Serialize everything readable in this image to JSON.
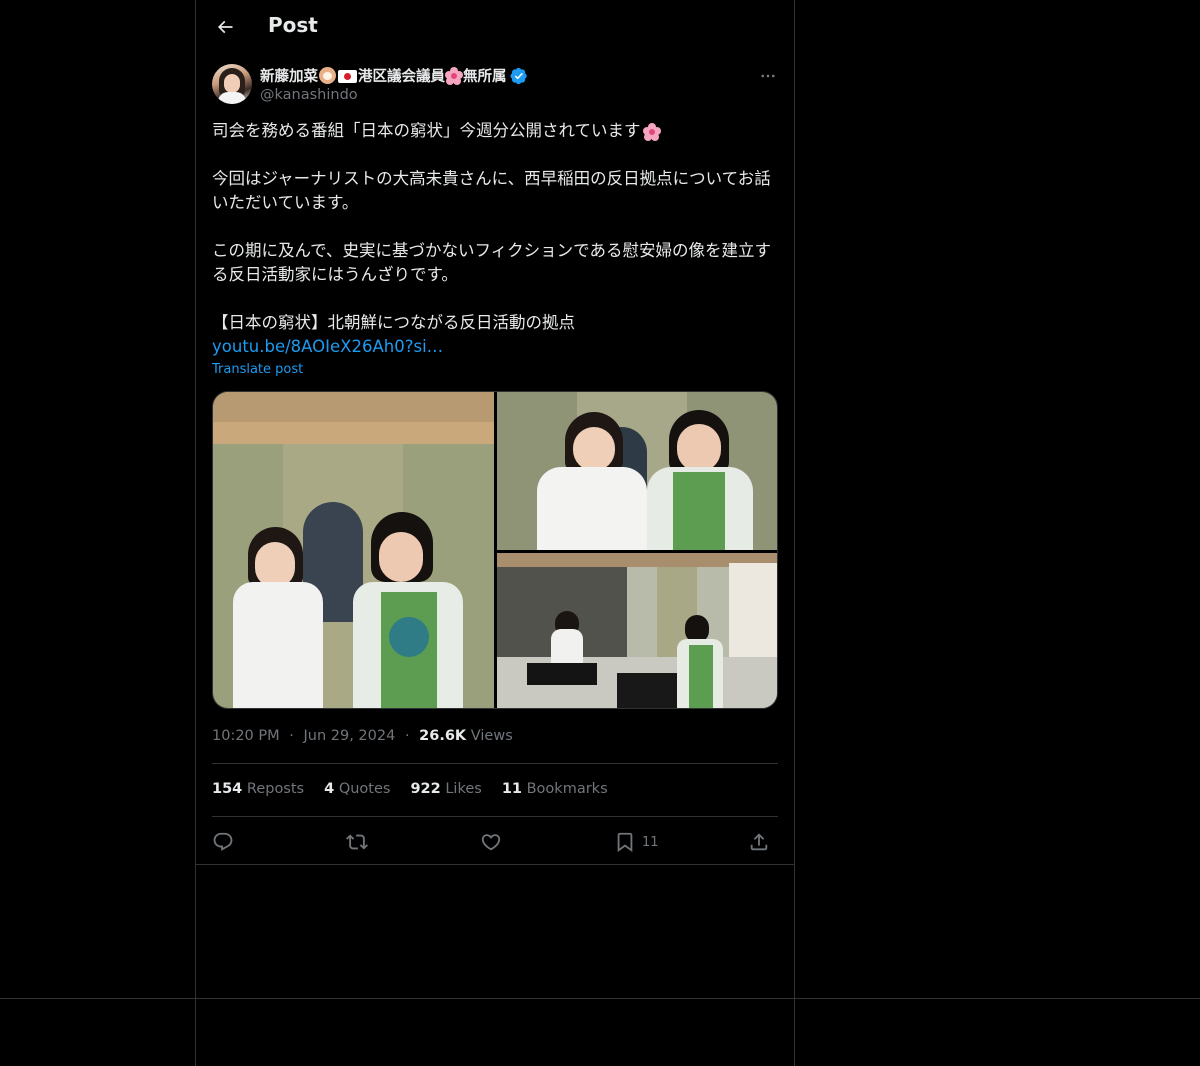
{
  "header": {
    "title": "Post"
  },
  "author": {
    "name_part1": "新藤加菜",
    "name_part2": "港区議会議員",
    "name_part3": "無所属",
    "handle": "@kanashindo"
  },
  "post": {
    "line1": "司会を務める番組「日本の窮状」今週分公開されています",
    "para2": "今回はジャーナリストの大高未貴さんに、西早稲田の反日拠点についてお話いただいています。",
    "para3": "この期に及んで、史実に基づかないフィクションである慰安婦の像を建立する反日活動家にはうんざりです。",
    "para4": "【日本の窮状】北朝鮮につながる反日活動の拠点",
    "link": "youtu.be/8AOIeX26Ah0?si…",
    "translate": "Translate post"
  },
  "meta": {
    "time": "10:20 PM",
    "dot": "·",
    "date": "Jun 29, 2024",
    "views_count": "26.6K",
    "views_label": "Views"
  },
  "stats": {
    "reposts_count": "154",
    "reposts_label": "Reposts",
    "quotes_count": "4",
    "quotes_label": "Quotes",
    "likes_count": "922",
    "likes_label": "Likes",
    "bookmarks_count": "11",
    "bookmarks_label": "Bookmarks"
  },
  "actions": {
    "bookmark_count": "11"
  },
  "colors": {
    "background": "#000000",
    "text": "#e7e9ea",
    "muted": "#71767b",
    "accent": "#1d9bf0",
    "border": "#2f3336"
  },
  "icons": [
    "back-arrow-icon",
    "verified-badge-icon",
    "more-icon",
    "reply-icon",
    "repost-icon",
    "like-icon",
    "bookmark-icon",
    "share-icon"
  ]
}
